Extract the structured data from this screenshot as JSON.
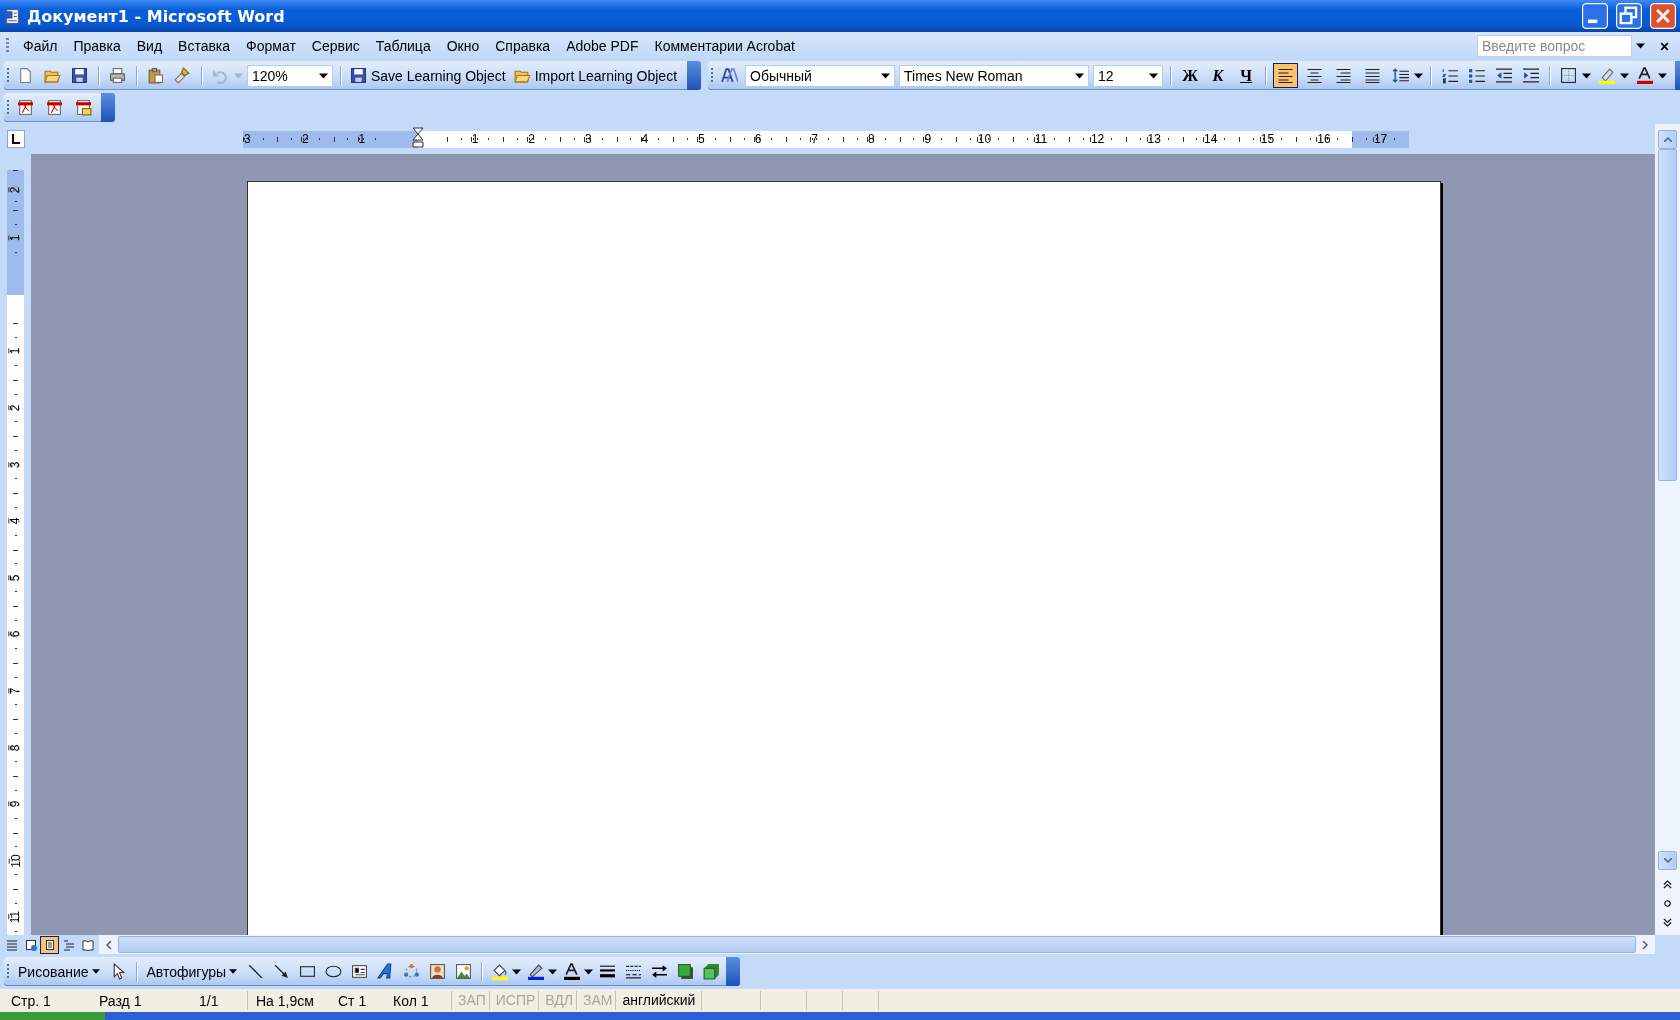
{
  "window": {
    "title": "Документ1 - Microsoft Word"
  },
  "menu": {
    "items": [
      "Файл",
      "Правка",
      "Вид",
      "Вставка",
      "Формат",
      "Сервис",
      "Таблица",
      "Окно",
      "Справка",
      "Adobe PDF",
      "Комментарии Acrobat"
    ],
    "help_placeholder": "Введите вопрос"
  },
  "standard_toolbar": {
    "zoom": "120%",
    "buttons": [
      "Save Learning Object",
      "Import Learning Object"
    ]
  },
  "formatting_toolbar": {
    "style": "Обычный",
    "font": "Times New Roman",
    "size": "12",
    "format_buttons": [
      {
        "label": "Ж",
        "kind": "bold"
      },
      {
        "label": "К",
        "kind": "italic"
      },
      {
        "label": "Ч",
        "kind": "underline"
      }
    ],
    "alignment": [
      {
        "kind": "left",
        "selected": true
      },
      {
        "kind": "center",
        "selected": false
      },
      {
        "kind": "right",
        "selected": false
      },
      {
        "kind": "justify",
        "selected": false
      }
    ]
  },
  "horizontal_ruler": {
    "marks": [
      {
        "label": "3",
        "margin": true
      },
      {
        "label": "2",
        "margin": true
      },
      {
        "label": "1",
        "margin": true
      },
      {
        "label": "1",
        "margin": false
      },
      {
        "label": "2",
        "margin": false
      },
      {
        "label": "3",
        "margin": false
      },
      {
        "label": "4",
        "margin": false
      },
      {
        "label": "5",
        "margin": false
      },
      {
        "label": "6",
        "margin": false
      },
      {
        "label": "7",
        "margin": false
      },
      {
        "label": "8",
        "margin": false
      },
      {
        "label": "9",
        "margin": false
      },
      {
        "label": "10",
        "margin": false
      },
      {
        "label": "11",
        "margin": false
      },
      {
        "label": "12",
        "margin": false
      },
      {
        "label": "13",
        "margin": false
      },
      {
        "label": "14",
        "margin": false
      },
      {
        "label": "15",
        "margin": false
      },
      {
        "label": "16",
        "margin": false
      },
      {
        "label": "17",
        "margin": true
      }
    ]
  },
  "vertical_ruler": {
    "marks": [
      {
        "label": "2",
        "margin": true
      },
      {
        "label": "1",
        "margin": true
      },
      {
        "label": "1",
        "margin": false
      },
      {
        "label": "2",
        "margin": false
      },
      {
        "label": "3",
        "margin": false
      },
      {
        "label": "4",
        "margin": false
      },
      {
        "label": "5",
        "margin": false
      },
      {
        "label": "6",
        "margin": false
      },
      {
        "label": "7",
        "margin": false
      },
      {
        "label": "8",
        "margin": false
      },
      {
        "label": "9",
        "margin": false
      },
      {
        "label": "10",
        "margin": false
      },
      {
        "label": "11",
        "margin": false
      }
    ]
  },
  "view_buttons": [
    {
      "kind": "normal",
      "selected": false
    },
    {
      "kind": "web",
      "selected": false
    },
    {
      "kind": "print",
      "selected": true
    },
    {
      "kind": "outline",
      "selected": false
    },
    {
      "kind": "reading",
      "selected": false
    }
  ],
  "drawing_toolbar": {
    "menu": "Рисование",
    "autoshapes": "Автофигуры"
  },
  "status_bar": {
    "panels": [
      {
        "cells": [
          "Стр. 1",
          "Разд 1",
          "1/1"
        ]
      },
      {
        "cells": [
          "На 1,9см",
          "Ст 1",
          "Кол 1"
        ]
      }
    ],
    "indicators": [
      {
        "text": "ЗАП",
        "disabled": true
      },
      {
        "text": "ИСПР",
        "disabled": true
      },
      {
        "text": "ВДЛ",
        "disabled": true
      },
      {
        "text": "ЗАМ",
        "disabled": true
      }
    ],
    "language": "английский"
  }
}
